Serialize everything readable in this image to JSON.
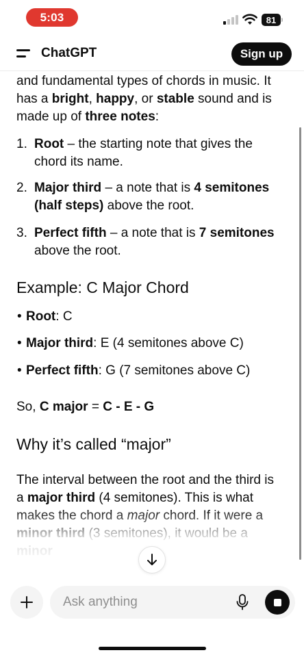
{
  "status_bar": {
    "time": "5:03",
    "battery": "81",
    "time_pill_color": "#e0382f"
  },
  "header": {
    "title": "ChatGPT",
    "signup_label": "Sign up",
    "menu_icon": "hamburger-menu-icon"
  },
  "message": {
    "intro": {
      "line1": "and fundamental types of chords in music. It",
      "line2_prefix": "has a ",
      "bright": "bright",
      "comma1": ", ",
      "happy": "happy",
      "or": ", or ",
      "stable": "stable",
      "line2_suffix": " sound and is",
      "line3_prefix": "made up of ",
      "three_notes": "three notes",
      "line3_suffix": ":"
    },
    "list": [
      {
        "num": "1.",
        "bold": "Root",
        "rest1": " – the starting note that gives the",
        "rest2": "chord its name."
      },
      {
        "num": "2.",
        "bold": "Major third",
        "mid": " – a note that is ",
        "bold2": "4 semitones",
        "line2_bold": "(half steps)",
        "line2_rest": " above the root."
      },
      {
        "num": "3.",
        "bold": "Perfect fifth",
        "mid": " – a note that is ",
        "bold2": "7 semitones",
        "line2_rest": "above the root."
      }
    ],
    "example_heading": "Example: C Major Chord",
    "example_items": [
      {
        "bold": "Root",
        "rest": ": C"
      },
      {
        "bold": "Major third",
        "rest": ": E (4 semitones above C)"
      },
      {
        "bold": "Perfect fifth",
        "rest": ": G (7 semitones above C)"
      }
    ],
    "so_line": {
      "prefix": "So, ",
      "bold1": "C major",
      "mid": " = ",
      "bold2": "C - E - G"
    },
    "why_heading": "Why it’s called “major”",
    "why_para": {
      "line1": "The interval between the root and the third is",
      "line2_prefix": "a ",
      "line2_bold": "major third",
      "line2_rest": " (4 semitones). This is what",
      "line3_prefix": "makes the chord a ",
      "line3_italic": "major",
      "line3_rest": " chord. If it were a",
      "line4_bold": "minor third",
      "line4_rest": " (3 semitones), it would be a",
      "line5_bold": "minor"
    }
  },
  "composer": {
    "placeholder": "Ask anything",
    "plus_icon": "plus-icon",
    "mic_icon": "microphone-icon",
    "stop_icon": "stop-icon"
  },
  "scroll_down_icon": "arrow-down-icon"
}
